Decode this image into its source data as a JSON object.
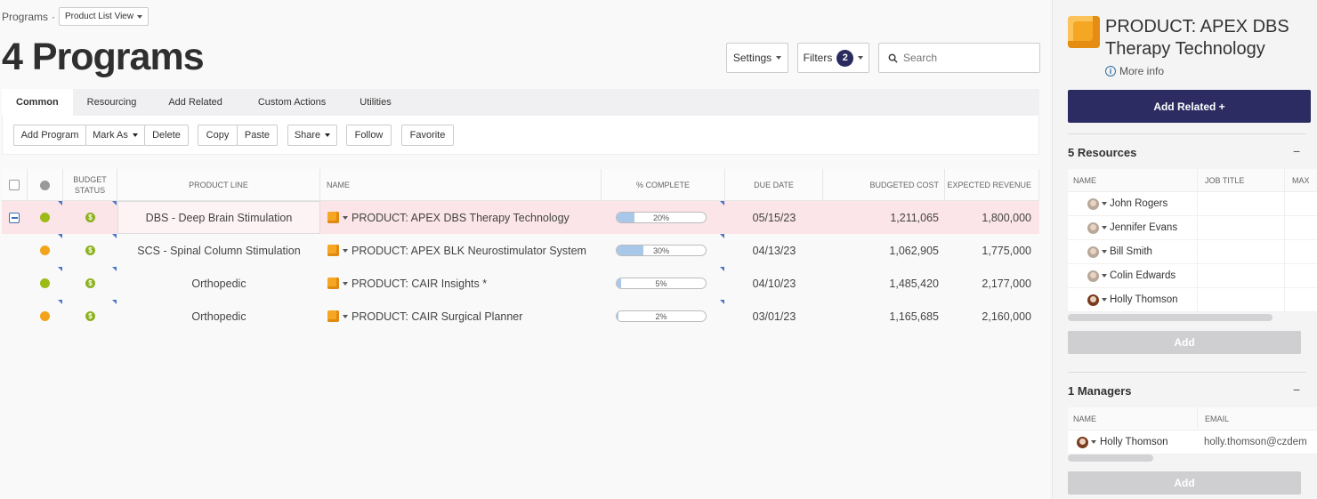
{
  "breadcrumb": {
    "root": "Programs",
    "sep": "·",
    "view": "Product List View"
  },
  "title": "4 Programs",
  "topbar": {
    "settings": "Settings",
    "filters": "Filters",
    "filter_count": "2",
    "search_placeholder": "Search"
  },
  "tabs": [
    "Common",
    "Resourcing",
    "Add Related",
    "Custom Actions",
    "Utilities"
  ],
  "toolbar": {
    "add_program": "Add Program",
    "mark_as": "Mark As",
    "delete": "Delete",
    "copy": "Copy",
    "paste": "Paste",
    "share": "Share",
    "follow": "Follow",
    "favorite": "Favorite"
  },
  "grid": {
    "headers": {
      "budget_status_1": "BUDGET",
      "budget_status_2": "STATUS",
      "product_line": "PRODUCT LINE",
      "name": "NAME",
      "pct_complete": "% COMPLETE",
      "due_date": "DUE DATE",
      "budgeted_cost": "BUDGETED COST",
      "expected_revenue": "EXPECTED REVENUE"
    },
    "rows": [
      {
        "status_color": "#9dbb17",
        "product_line": "DBS - Deep Brain Stimulation",
        "name": "PRODUCT: APEX DBS Therapy Technology",
        "pct": "20%",
        "pct_value": 0.2,
        "due": "05/15/23",
        "cost": "1,211,065",
        "revenue": "1,800,000"
      },
      {
        "status_color": "#f2a51a",
        "product_line": "SCS - Spinal Column Stimulation",
        "name": "PRODUCT: APEX BLK Neurostimulator System",
        "pct": "30%",
        "pct_value": 0.3,
        "due": "04/13/23",
        "cost": "1,062,905",
        "revenue": "1,775,000"
      },
      {
        "status_color": "#9dbb17",
        "product_line": "Orthopedic",
        "name": "PRODUCT: CAIR Insights *",
        "pct": "5%",
        "pct_value": 0.05,
        "due": "04/10/23",
        "cost": "1,485,420",
        "revenue": "2,177,000"
      },
      {
        "status_color": "#f2a51a",
        "product_line": "Orthopedic",
        "name": "PRODUCT: CAIR Surgical Planner",
        "pct": "2%",
        "pct_value": 0.02,
        "due": "03/01/23",
        "cost": "1,165,685",
        "revenue": "2,160,000"
      }
    ]
  },
  "side": {
    "title": "PRODUCT: APEX DBS Therapy Technology",
    "more_info": "More info",
    "add_related": "Add Related +",
    "resources": {
      "heading": "5 Resources",
      "col_name": "NAME",
      "col_job": "JOB TITLE",
      "col_max": "MAX",
      "people": [
        "John Rogers",
        "Jennifer Evans",
        "Bill Smith",
        "Colin Edwards",
        "Holly Thomson"
      ],
      "add": "Add"
    },
    "managers": {
      "heading": "1 Managers",
      "col_name": "NAME",
      "col_email": "EMAIL",
      "people": [
        {
          "name": "Holly Thomson",
          "email": "holly.thomson@czdem"
        }
      ],
      "add": "Add"
    },
    "collapse": "−"
  }
}
